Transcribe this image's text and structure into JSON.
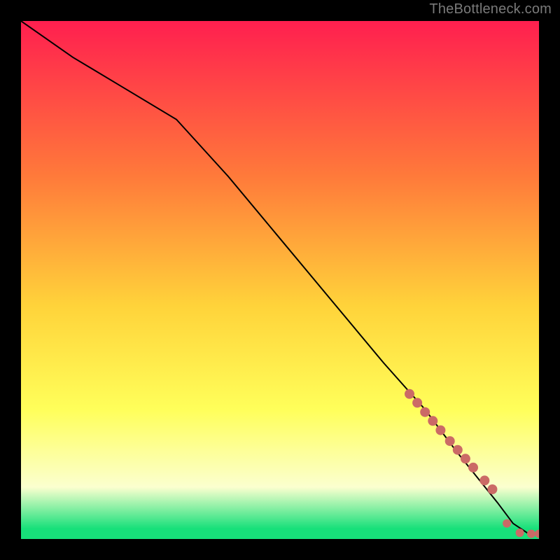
{
  "attribution": "TheBottleneck.com",
  "colors": {
    "top": "#ff1f4f",
    "mid1": "#ff7a3a",
    "mid2": "#ffd33a",
    "mid3": "#ffff5a",
    "pale": "#fbffcf",
    "green": "#17e07a",
    "dot": "#cb6a66",
    "line": "#000000"
  },
  "chart_data": {
    "type": "line",
    "title": "",
    "xlabel": "",
    "ylabel": "",
    "xlim": [
      0,
      100
    ],
    "ylim": [
      0,
      100
    ],
    "series": [
      {
        "name": "curve",
        "x": [
          0,
          10,
          20,
          30,
          40,
          50,
          60,
          70,
          78,
          84,
          88,
          92,
          95,
          98,
          100
        ],
        "y": [
          100,
          93,
          87,
          81,
          70,
          58,
          46,
          34,
          25,
          17,
          12,
          7,
          3,
          1,
          1
        ]
      }
    ],
    "markers": {
      "name": "highlight-dots",
      "x": [
        75,
        76.5,
        78,
        79.5,
        81,
        82.8,
        84.3,
        85.8,
        87.3,
        89.5,
        91,
        93.8,
        96.3,
        98.5,
        100
      ],
      "y": [
        28,
        26.3,
        24.5,
        22.8,
        21,
        18.9,
        17.2,
        15.5,
        13.8,
        11.3,
        9.6,
        3.0,
        1.2,
        1.0,
        1.0
      ],
      "r": [
        7,
        7,
        7,
        7,
        7,
        7,
        7,
        7,
        7,
        7,
        7,
        6,
        6,
        6,
        6
      ]
    }
  }
}
